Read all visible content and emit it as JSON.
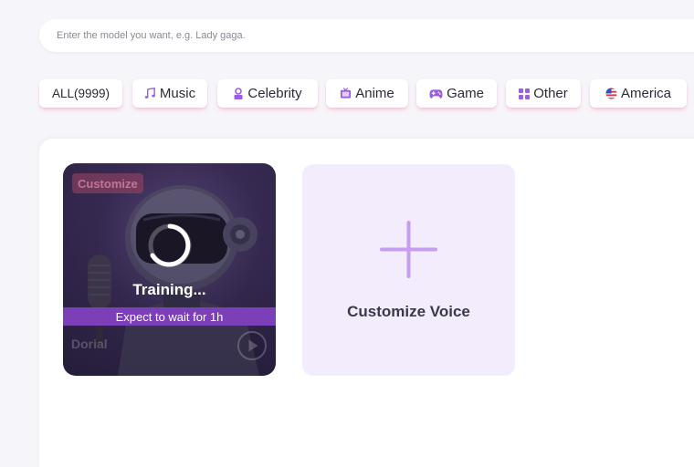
{
  "search": {
    "placeholder": "Enter the model you want, e.g. Lady gaga."
  },
  "categories": [
    {
      "label": "ALL(9999)",
      "icon": ""
    },
    {
      "label": "Music",
      "icon": "music-note-icon"
    },
    {
      "label": "Celebrity",
      "icon": "person-badge-icon"
    },
    {
      "label": "Anime",
      "icon": "tv-icon"
    },
    {
      "label": "Game",
      "icon": "gamepad-icon"
    },
    {
      "label": "Other",
      "icon": "grid-icon"
    },
    {
      "label": "America",
      "icon": "us-flag-icon"
    }
  ],
  "training_card": {
    "badge": "Customize",
    "status": "Training...",
    "wait_note": "Expect to wait for 1h",
    "name": "Dorial"
  },
  "custom_card": {
    "label": "Customize Voice"
  },
  "colors": {
    "accent": "#7b3fb8",
    "icon": "#9b5de5",
    "plus": "#c79df0",
    "custom_card_bg": "#f3ecfd"
  }
}
